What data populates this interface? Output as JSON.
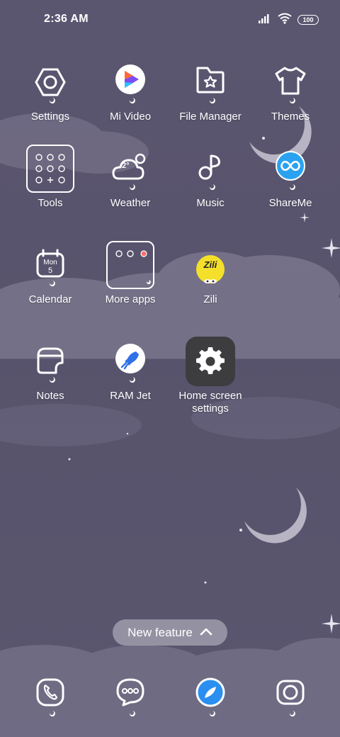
{
  "status_bar": {
    "time": "2:36 AM",
    "battery": "100",
    "icons": [
      "signal-icon",
      "wifi-icon",
      "battery-icon"
    ]
  },
  "apps": {
    "settings": "Settings",
    "mi_video": "Mi Video",
    "file_manager": "File Manager",
    "themes": "Themes",
    "tools": "Tools",
    "weather": "Weather",
    "music": "Music",
    "shareme": "ShareMe",
    "calendar": "Calendar",
    "more_apps": "More apps",
    "zili": "Zili",
    "notes": "Notes",
    "ram_jet": "RAM Jet",
    "home_screen_settings": "Home screen\nsettings"
  },
  "weather_icon_text": "2°",
  "calendar_icon": {
    "day": "Mon",
    "date": "5"
  },
  "zili_logo": "Zili",
  "new_feature": {
    "label": "New feature",
    "icon": "chevron-up-icon"
  },
  "dock": [
    "phone-icon",
    "messages-icon",
    "browser-icon",
    "camera-icon"
  ],
  "colors": {
    "wallpaper": "#58536c",
    "icon_line": "#ffffff",
    "zili_yellow": "#f4e02a",
    "shareme_blue": "#2aa2f0",
    "home_settings_tile": "#3d3d3f"
  }
}
